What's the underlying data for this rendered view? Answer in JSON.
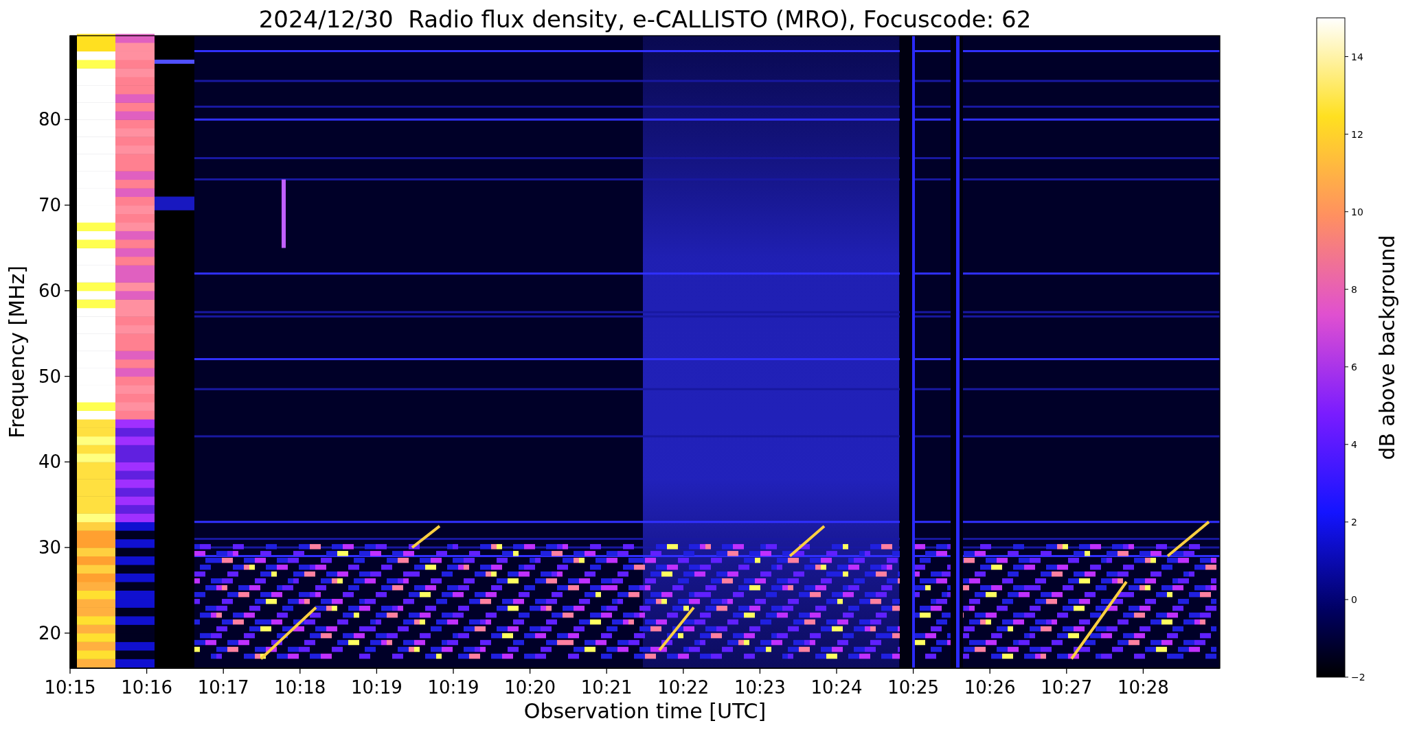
{
  "title": "2024/12/30  Radio flux density, e-CALLISTO (MRO), Focuscode: 62",
  "y_axis": {
    "label": "Frequency [MHz]",
    "ticks": [
      "80",
      "70",
      "60",
      "50",
      "40",
      "30",
      "20"
    ]
  },
  "x_axis": {
    "label": "Observation time [UTC]",
    "ticks": [
      "10:15",
      "10:16",
      "10:17",
      "10:18",
      "10:19",
      "10:19",
      "10:20",
      "10:21",
      "10:22",
      "10:23",
      "10:24",
      "10:25",
      "10:26",
      "10:27",
      "10:28"
    ]
  },
  "colorbar": {
    "label": "dB above background",
    "ticks": [
      "14",
      "12",
      "10",
      "8",
      "6",
      "4",
      "2",
      "0",
      "−2"
    ]
  }
}
